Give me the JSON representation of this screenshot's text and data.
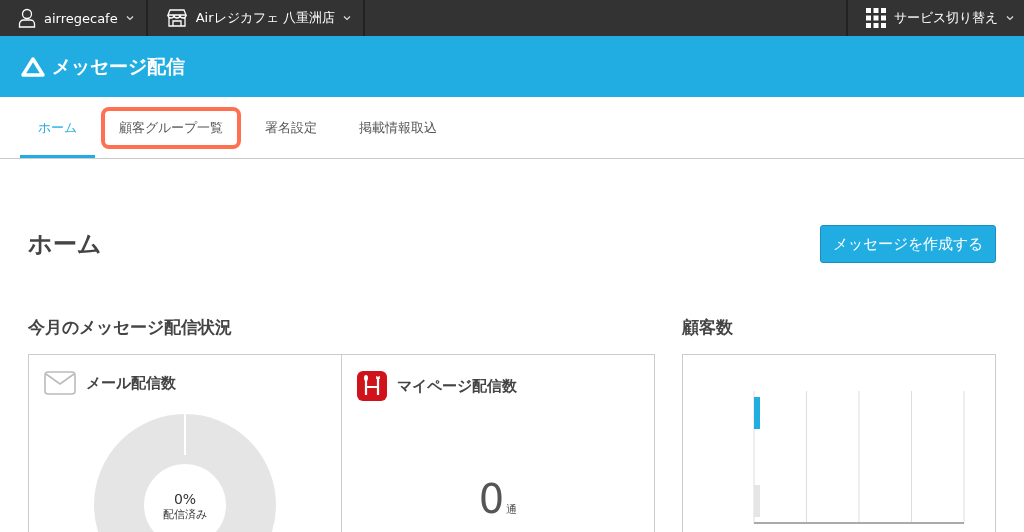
{
  "top_bar": {
    "account": "airregecafe",
    "store": "Airレジカフェ 八重洲店",
    "service_switch": "サービス切り替え"
  },
  "app_header": {
    "title": "メッセージ配信"
  },
  "tabs": [
    {
      "label": "ホーム",
      "selected": true,
      "highlighted": false
    },
    {
      "label": "顧客グループ一覧",
      "selected": false,
      "highlighted": true
    },
    {
      "label": "署名設定",
      "selected": false,
      "highlighted": false
    },
    {
      "label": "掲載情報取込",
      "selected": false,
      "highlighted": false
    }
  ],
  "page": {
    "title": "ホーム",
    "create_button": "メッセージを作成する"
  },
  "status_section": {
    "title": "今月のメッセージ配信状況",
    "cards": [
      {
        "kind": "donut",
        "title": "メール配信数",
        "percent": "0%",
        "caption": "配信済み"
      },
      {
        "kind": "count",
        "title": "マイページ配信数",
        "count": "0",
        "unit": "通"
      }
    ]
  },
  "customers_section": {
    "title": "顧客数"
  }
}
